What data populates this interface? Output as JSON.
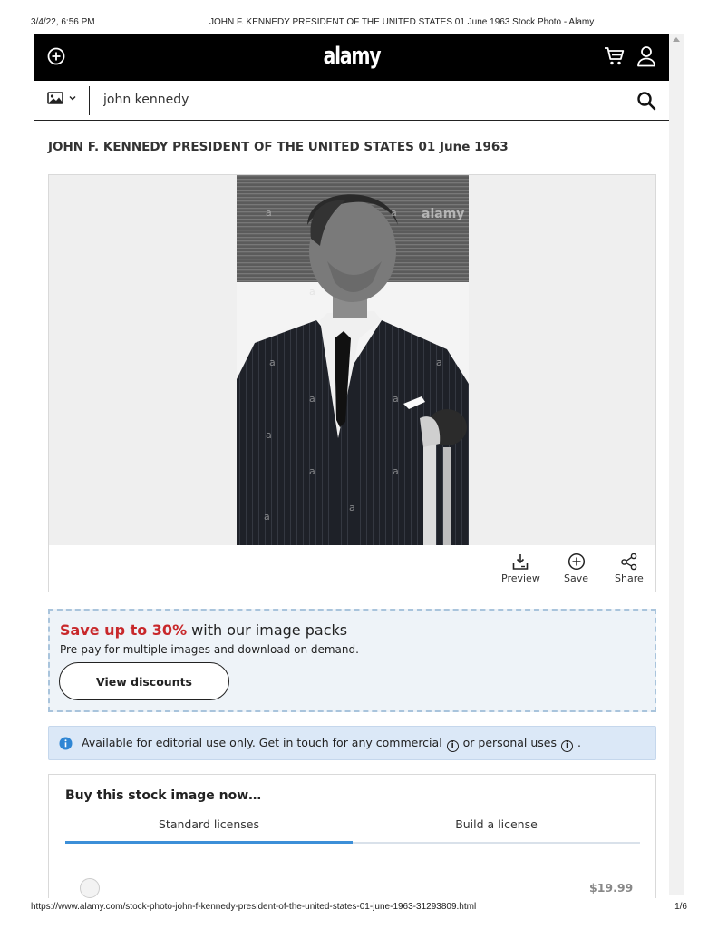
{
  "print_header": {
    "datetime": "3/4/22, 6:56 PM",
    "doc_title": "JOHN F. KENNEDY PRESIDENT OF THE UNITED STATES 01 June 1963 Stock Photo - Alamy"
  },
  "print_footer": {
    "url": "https://www.alamy.com/stock-photo-john-f-kennedy-president-of-the-united-states-01-june-1963-31293809.html",
    "page": "1/6"
  },
  "topbar": {
    "logo": "alamy",
    "icons": [
      "add-circle-icon",
      "cart-icon",
      "user-icon"
    ],
    "background": "#000000"
  },
  "search": {
    "type_icon": "image-icon",
    "query": "john kennedy"
  },
  "page_title": "JOHN F. KENNEDY PRESIDENT OF THE UNITED STATES 01 June 1963",
  "image_panel": {
    "watermark": "alamy",
    "actions": [
      {
        "label": "Preview",
        "icon": "download-preview-icon"
      },
      {
        "label": "Save",
        "icon": "add-circle-icon"
      },
      {
        "label": "Share",
        "icon": "share-icon"
      }
    ]
  },
  "promo": {
    "highlight": "Save up to 30%",
    "headline_rest": " with our image packs",
    "subtext": "Pre-pay for multiple images and download on demand.",
    "button": "View discounts",
    "highlight_color": "#c8282b"
  },
  "notice": {
    "part1": "Available for editorial use only. Get in touch for any commercial",
    "part2": "or personal uses",
    "part3": ".",
    "info_glyph": "i"
  },
  "buy": {
    "heading": "Buy this stock image now…",
    "tabs": [
      "Standard licenses",
      "Build a license"
    ],
    "active_tab": 0,
    "first_price": "$19.99",
    "accent": "#3c8fd8"
  }
}
